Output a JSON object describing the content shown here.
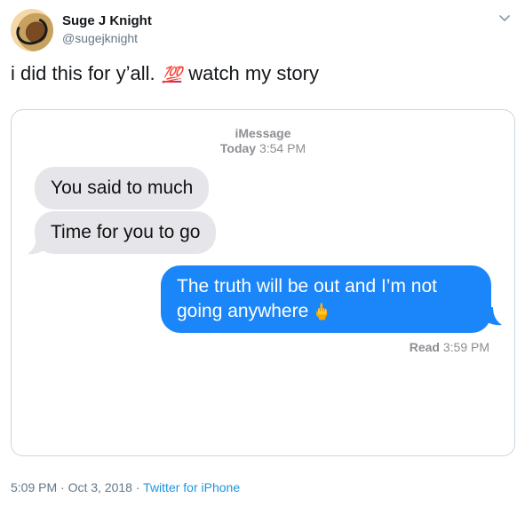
{
  "tweet": {
    "author_name": "Suge J Knight",
    "author_handle": "@sugejknight",
    "text_before": "i did this for y’all.",
    "emoji": "💯",
    "text_after": "watch my story",
    "timestamp": "5:09 PM · Oct 3, 2018",
    "separator": "·",
    "source": "Twitter for iPhone"
  },
  "screenshot": {
    "service_label": "iMessage",
    "date_prefix": "Today",
    "date_time": "3:54 PM",
    "messages_received": [
      "You said to much",
      "Time for you to go"
    ],
    "message_sent": "The truth will be out and I’m not going anywhere",
    "sent_emoji": "🖕",
    "read_label": "Read",
    "read_time": "3:59 PM"
  },
  "icons": {
    "chevron": "chevron-down-icon",
    "hundred": "hundred-points-emoji"
  },
  "colors": {
    "sent_bubble": "#1b86f9",
    "received_bubble": "#e5e5ea",
    "link": "#1b95e0",
    "secondary_text": "#657786"
  }
}
